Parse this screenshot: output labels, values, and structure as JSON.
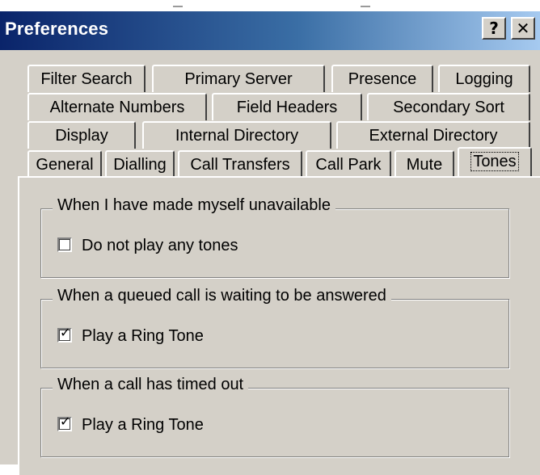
{
  "window": {
    "title": "Preferences"
  },
  "title_buttons": {
    "help": "?",
    "close": "✕"
  },
  "tabs": {
    "row1": [
      "Filter Search",
      "Primary Server",
      "Presence",
      "Logging"
    ],
    "row2": [
      "Alternate Numbers",
      "Field Headers",
      "Secondary Sort"
    ],
    "row3": [
      "Display",
      "Internal Directory",
      "External Directory"
    ],
    "row4": [
      "General",
      "Dialling",
      "Call Transfers",
      "Call Park",
      "Mute",
      "Tones"
    ],
    "active": "Tones"
  },
  "groups": [
    {
      "legend": "When I have made myself unavailable",
      "checkbox_label": "Do not play any tones",
      "checked": false
    },
    {
      "legend": "When a queued call is waiting to be answered",
      "checkbox_label": "Play a Ring Tone",
      "checked": true
    },
    {
      "legend": "When a call has timed out",
      "checkbox_label": "Play a Ring Tone",
      "checked": true
    }
  ]
}
